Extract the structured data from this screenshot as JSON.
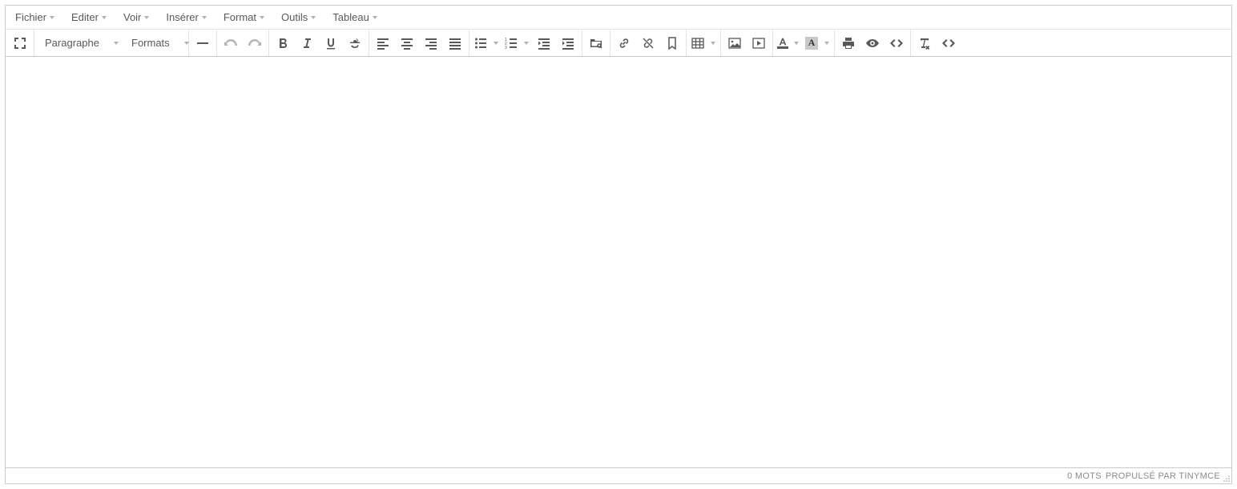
{
  "menubar": {
    "file": "Fichier",
    "edit": "Editer",
    "view": "Voir",
    "insert": "Insérer",
    "format": "Format",
    "tools": "Outils",
    "table": "Tableau"
  },
  "toolbar": {
    "paragraph_label": "Paragraphe",
    "formats_label": "Formats"
  },
  "status": {
    "word_count": "0 MOTS",
    "branding": "PROPULSÉ PAR TINYMCE"
  },
  "colors": {
    "text": "#595959",
    "disabled": "#b5b5b5",
    "border": "#cacaca"
  }
}
